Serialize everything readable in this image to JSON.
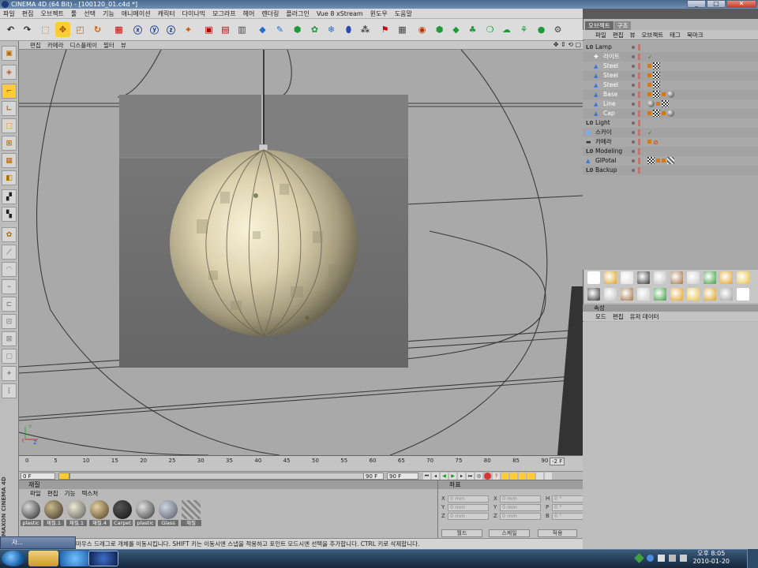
{
  "window": {
    "title": "CINEMA 4D (64 Bit) - [100120_01.c4d *]",
    "buttons": [
      "_",
      "□",
      "✕"
    ]
  },
  "menubar": [
    "파일",
    "편집",
    "오브젝트",
    "툴",
    "선택",
    "기능",
    "애니메이션",
    "캐릭터",
    "다이나믹",
    "모그라프",
    "헤어",
    "렌더링",
    "플러그인",
    "Vue 8 xStream",
    "윈도우",
    "도움말"
  ],
  "viewport": {
    "menu": [
      "편집",
      "카메라",
      "디스플레이",
      "필터",
      "뷰"
    ],
    "nav_icons": [
      "move-view-icon",
      "zoom-view-icon",
      "rotate-view-icon",
      "maximize-view-icon"
    ],
    "axis_labels": {
      "x": "X",
      "y": "Y",
      "z": "Z"
    }
  },
  "timeline": {
    "ticks": [
      "0",
      "5",
      "10",
      "15",
      "20",
      "25",
      "30",
      "35",
      "40",
      "45",
      "50",
      "55",
      "60",
      "65",
      "70",
      "75",
      "80",
      "85",
      "90"
    ],
    "end_marker": "-2 F",
    "current_frame": "0 F",
    "start_field": "0 F",
    "min_field": "90 F",
    "max_field": "90 F"
  },
  "materials": {
    "title": "재질",
    "menu": [
      "파일",
      "편집",
      "기능",
      "텍스처"
    ],
    "items": [
      {
        "label": "plastic",
        "color": "#d8d8d8",
        "dark": "#222"
      },
      {
        "label": "재질.1",
        "color": "#c9b98e",
        "dark": "#3a3020"
      },
      {
        "label": "재질.1",
        "color": "#efe9d4",
        "dark": "#555"
      },
      {
        "label": "재질.4",
        "color": "#e4d0a2",
        "dark": "#4b3a1c"
      },
      {
        "label": "Carpet",
        "color": "#555",
        "dark": "#111"
      },
      {
        "label": "plastic",
        "color": "#e0e0e0",
        "dark": "#333"
      },
      {
        "label": "Glass",
        "color": "#ccd6de",
        "dark": "#556"
      },
      {
        "label": "재질",
        "color": "#aaa",
        "dark": "#777"
      }
    ]
  },
  "coords": {
    "title": "좌표",
    "rows": [
      {
        "a": "X",
        "v1": "0 mm",
        "b": "X",
        "v2": "0 mm",
        "c": "H",
        "v3": "0 °"
      },
      {
        "a": "Y",
        "v1": "0 mm",
        "b": "Y",
        "v2": "0 mm",
        "c": "P",
        "v3": "0 °"
      },
      {
        "a": "Z",
        "v1": "0 mm",
        "b": "Z",
        "v2": "0 mm",
        "c": "B",
        "v3": "0 °"
      }
    ],
    "mode1": "월드",
    "mode2": "스케일",
    "apply": "적용"
  },
  "statusbar": "마우스 드래그로 개체를 이동시킵니다. SHIFT 키는 이동시엔 스냅을 적용하고 포인트 모드시엔 선택을 추가합니다. CTRL 키로 삭제합니다.",
  "mini_window": "자...",
  "objects": {
    "tabs": [
      "오브젝트",
      "구조"
    ],
    "menu": [
      "파일",
      "편집",
      "뷰",
      "오브젝트",
      "태그",
      "북마크"
    ],
    "items": [
      {
        "name": "Lamp",
        "indent": 0,
        "icon": "null-object-icon",
        "tags": []
      },
      {
        "name": "라이트",
        "indent": 1,
        "icon": "light-icon",
        "tags": [
          "check"
        ]
      },
      {
        "name": "Steel",
        "indent": 1,
        "icon": "cone-icon",
        "tags": [
          "sm",
          "chk"
        ]
      },
      {
        "name": "Steel",
        "indent": 1,
        "icon": "cone-icon",
        "tags": [
          "sm",
          "chk"
        ]
      },
      {
        "name": "Steel",
        "indent": 1,
        "icon": "cone-icon",
        "tags": [
          "sm",
          "chk"
        ]
      },
      {
        "name": "Base",
        "indent": 1,
        "icon": "cone-icon",
        "tags": [
          "sm",
          "chk",
          "sm",
          "ball"
        ]
      },
      {
        "name": "Line",
        "indent": 1,
        "icon": "cone-icon",
        "tags": [
          "ball",
          "sm",
          "chk"
        ]
      },
      {
        "name": "Cap",
        "indent": 1,
        "icon": "cone-icon",
        "tags": [
          "sm",
          "chk",
          "sm",
          "ball"
        ]
      },
      {
        "name": "Light",
        "indent": 0,
        "icon": "null-object-icon",
        "tags": []
      },
      {
        "name": "스카이",
        "indent": 0,
        "icon": "sky-icon",
        "tags": [
          "check"
        ]
      },
      {
        "name": "카메라",
        "indent": 0,
        "icon": "camera-icon",
        "tags": [
          "sm",
          "no"
        ]
      },
      {
        "name": "Modeling",
        "indent": 0,
        "icon": "null-object-icon",
        "tags": []
      },
      {
        "name": "GIPotal",
        "indent": 0,
        "icon": "cone-icon",
        "tags": [
          "chk",
          "sm",
          "sm",
          "stripe"
        ]
      },
      {
        "name": "Backup",
        "indent": 0,
        "icon": "null-object-icon",
        "tags": []
      }
    ]
  },
  "attributes": {
    "title": "속성",
    "menu": [
      "모드",
      "편집",
      "유저 데이터"
    ]
  },
  "taskbar": {
    "clock_time": "오후 8:05",
    "clock_date": "2010-01-20"
  },
  "brand": "MAXON CINEMA 4D",
  "colors": {
    "accent": "#f0a020",
    "select": "#ffcc33",
    "titlebar": "#4a6a8e"
  }
}
